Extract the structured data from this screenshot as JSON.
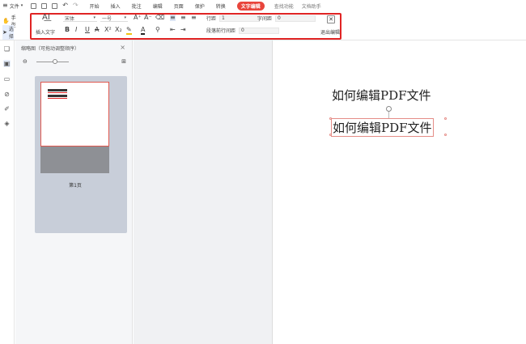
{
  "menubar": {
    "file_label": "文件",
    "tabs": [
      "开始",
      "插入",
      "批注",
      "编辑",
      "页面",
      "保护",
      "转换",
      "文字编辑"
    ],
    "active_tab": "文字编辑",
    "right_items": [
      "查找功能",
      "文档助手"
    ]
  },
  "ribbon": {
    "insert_text_label": "插入文字",
    "font_name": "宋体",
    "font_size": "一号",
    "line_spacing_label": "行距",
    "line_spacing_value": "1",
    "char_spacing_label": "字间距",
    "char_spacing_value": "0",
    "para_spacing_label": "段落前行间距",
    "para_spacing_value": "0",
    "exit_label": "退出编辑"
  },
  "sidebar": {
    "hand_tool": "手型",
    "select_tool": "选择"
  },
  "thumbnail_panel": {
    "title": "缩略图（可拖动调整顺序）",
    "page_label": "第1页"
  },
  "document": {
    "line1": "如何编辑PDF文件",
    "line2": "如何编辑PDF文件"
  },
  "colors": {
    "accent": "#e8453c",
    "highlight_border": "#e02424"
  }
}
